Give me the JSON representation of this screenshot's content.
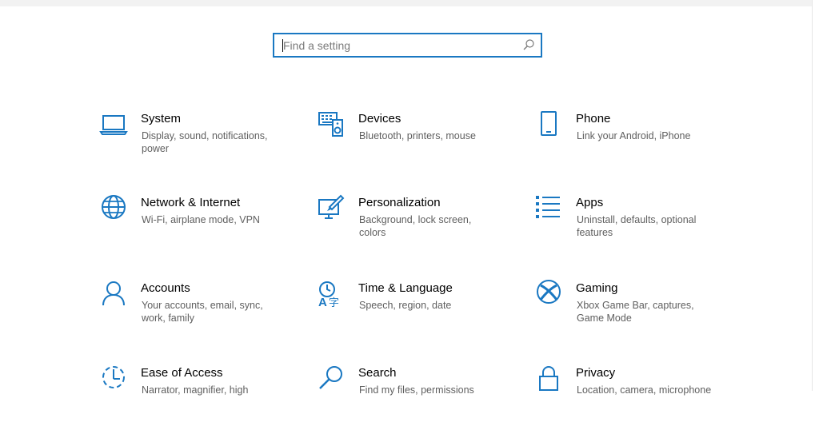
{
  "search": {
    "placeholder": "Find a setting",
    "icon": "search-icon"
  },
  "accent_color": "#1a78c2",
  "tiles": [
    {
      "title": "System",
      "desc": "Display, sound, notifications, power",
      "icon": "laptop-icon"
    },
    {
      "title": "Devices",
      "desc": "Bluetooth, printers, mouse",
      "icon": "keyboard-speaker-icon"
    },
    {
      "title": "Phone",
      "desc": "Link your Android, iPhone",
      "icon": "phone-icon"
    },
    {
      "title": "Network & Internet",
      "desc": "Wi-Fi, airplane mode, VPN",
      "icon": "globe-icon"
    },
    {
      "title": "Personalization",
      "desc": "Background, lock screen, colors",
      "icon": "paintbrush-icon"
    },
    {
      "title": "Apps",
      "desc": "Uninstall, defaults, optional features",
      "icon": "apps-list-icon"
    },
    {
      "title": "Accounts",
      "desc": "Your accounts, email, sync, work, family",
      "icon": "person-icon"
    },
    {
      "title": "Time & Language",
      "desc": "Speech, region, date",
      "icon": "time-language-icon"
    },
    {
      "title": "Gaming",
      "desc": "Xbox Game Bar, captures, Game Mode",
      "icon": "xbox-icon"
    },
    {
      "title": "Ease of Access",
      "desc": "Narrator, magnifier, high",
      "icon": "ease-of-access-icon"
    },
    {
      "title": "Search",
      "desc": "Find my files, permissions",
      "icon": "magnifier-icon"
    },
    {
      "title": "Privacy",
      "desc": "Location, camera, microphone",
      "icon": "lock-icon"
    }
  ]
}
